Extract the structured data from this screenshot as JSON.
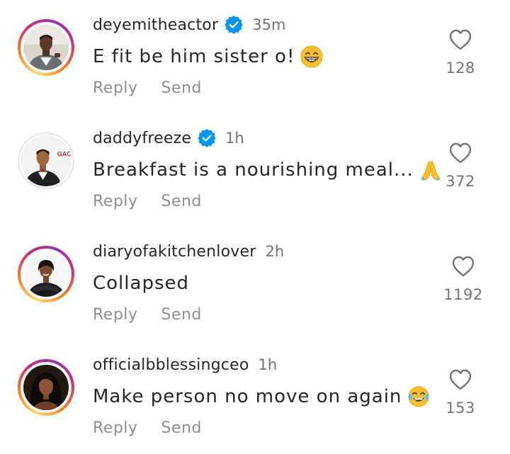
{
  "comments": [
    {
      "username": "deyemitheactor",
      "verified": true,
      "time": "35m",
      "text": "E fit be him sister o!",
      "emoji": "grinning-face-with-smiling-eyes",
      "likes": "128",
      "reply_label": "Reply",
      "send_label": "Send",
      "has_story": true
    },
    {
      "username": "daddyfreeze",
      "verified": true,
      "time": "1h",
      "text": "Breakfast is a nourishing meal...",
      "emoji": "folded-hands",
      "likes": "372",
      "reply_label": "Reply",
      "send_label": "Send",
      "has_story": false
    },
    {
      "username": "diaryofakitchenlover",
      "verified": false,
      "time": "2h",
      "text": "Collapsed",
      "emoji": "",
      "likes": "1192",
      "reply_label": "Reply",
      "send_label": "Send",
      "has_story": true
    },
    {
      "username": "officialbblessingceo",
      "verified": false,
      "time": "1h",
      "text": "Make person no move on again",
      "emoji": "face-with-tears-of-joy",
      "likes": "153",
      "reply_label": "Reply",
      "send_label": "Send",
      "has_story": true
    }
  ],
  "colors": {
    "verified_blue": "#0095f6",
    "text_primary": "#262626",
    "text_secondary": "#737373",
    "story_ring": [
      "#feda75",
      "#fa7e1e",
      "#d62976",
      "#962fbf"
    ]
  }
}
